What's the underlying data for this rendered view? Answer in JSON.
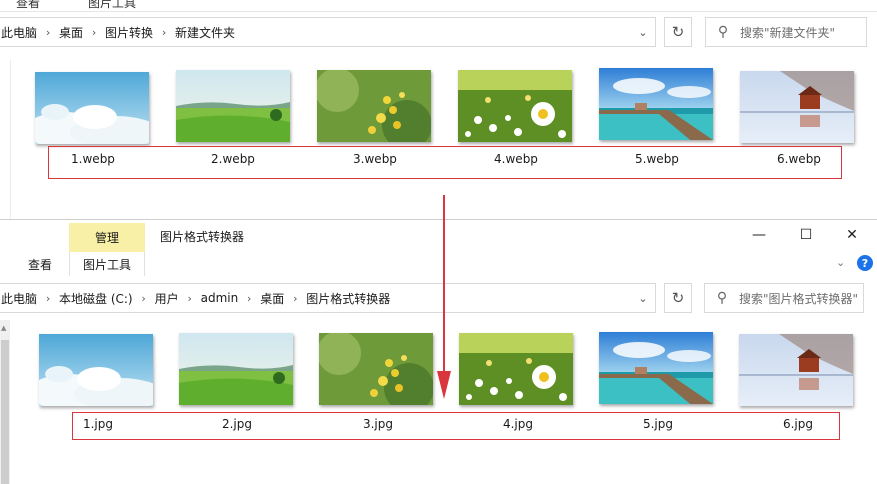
{
  "top_window": {
    "ribbon_tabs": [
      "查看",
      "图片工具"
    ],
    "breadcrumb": [
      "此电脑",
      "桌面",
      "图片转换",
      "新建文件夹"
    ],
    "search_placeholder": "搜索\"新建文件夹\"",
    "files": [
      "1.webp",
      "2.webp",
      "3.webp",
      "4.webp",
      "5.webp",
      "6.webp"
    ]
  },
  "bottom_window": {
    "manage_tab": "管理",
    "title": "图片格式转换器",
    "ribbon_tabs": [
      "查看",
      "图片工具"
    ],
    "breadcrumb": [
      "此电脑",
      "本地磁盘 (C:)",
      "用户",
      "admin",
      "桌面",
      "图片格式转换器"
    ],
    "search_placeholder": "搜索\"图片格式转换器\"",
    "files": [
      "1.jpg",
      "2.jpg",
      "3.jpg",
      "4.jpg",
      "5.jpg",
      "6.jpg"
    ]
  },
  "images": [
    "sky-clouds",
    "green-meadow",
    "rapeseed-flowers",
    "daisies",
    "pier-sea",
    "lake-boathouse"
  ],
  "colors": {
    "accent_red": "#d9363e",
    "manage_tab_bg": "#f7f0a6",
    "help_blue": "#1a73e8"
  },
  "icons": {
    "dropdown": "chevron-down-icon",
    "refresh": "refresh-icon",
    "search": "search-icon",
    "separator": "chevron-right-icon",
    "minimize": "minimize-icon",
    "maximize": "maximize-icon",
    "close": "close-icon",
    "help": "help-icon"
  }
}
